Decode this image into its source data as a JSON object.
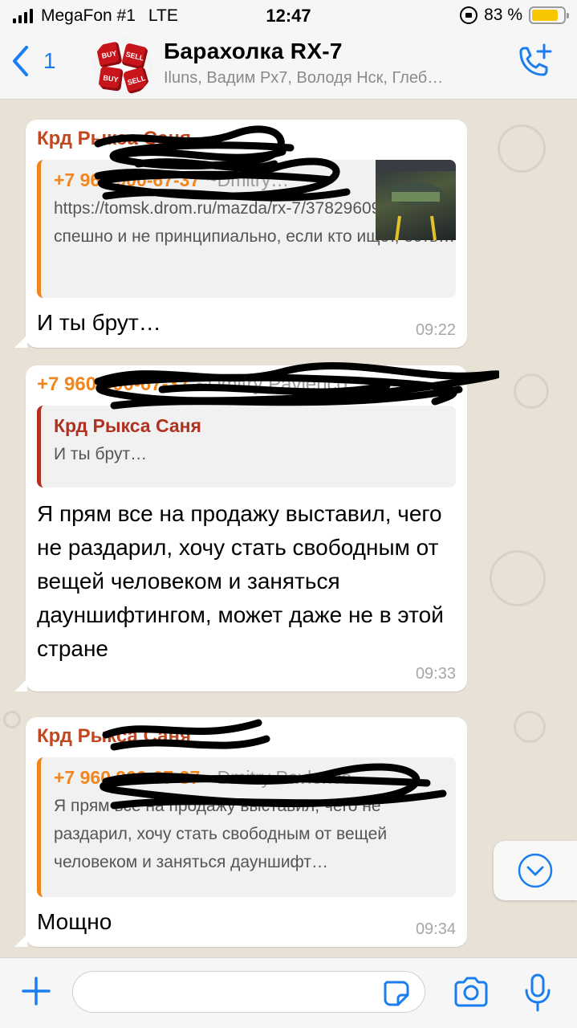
{
  "status_bar": {
    "carrier": "MegaFon #1",
    "network": "LTE",
    "time": "12:47",
    "battery": "83 %",
    "battery_level": 0.83
  },
  "header": {
    "back_count": "1",
    "title": "Барахолка RX-7",
    "subtitle": "Iluns, Вадим Px7, Володя Нск, Глеб…",
    "avatar_dice": [
      "BUY",
      "BUY",
      "SELL",
      "SELL"
    ]
  },
  "messages": [
    {
      "sender": "Крд Рыкса Саня",
      "quote_author": "+7 960 900-67-37",
      "quote_author_extra": "~Dmitry…",
      "quote_text": "https://tomsk.drom.ru/mazda/rx-7/37829609.html не спешно и не принципиально, если кто ищет, есть…",
      "text": "И ты брут…",
      "time": "09:22"
    },
    {
      "sender": "+7 960 900-67-37",
      "sender_extra": "~Dmitry Pavlenco",
      "quote_author": "Крд Рыкса Саня",
      "quote_text": "И ты брут…",
      "text": "Я прям все на продажу выставил, чего не раздарил, хочу стать свободным от вещей человеком и заняться дауншифтингом, может даже не в этой стране",
      "time": "09:33"
    },
    {
      "sender": "Крд Рыкса Саня",
      "quote_author": "+7 960 900-67-37",
      "quote_author_extra": "~Dmitry Pavlenco",
      "quote_text": "Я прям все на продажу выставил, чего не раздарил, хочу стать свободным от вещей человеком и заняться дауншифт…",
      "text": "Мощно",
      "time": "09:34"
    }
  ],
  "input": {
    "placeholder": "",
    "value": ""
  },
  "colors": {
    "accent": "#1a7ef1",
    "sender_red": "#c2461f",
    "sender_orange": "#f0861d",
    "battery": "#f7c600"
  },
  "icons": [
    "back-chevron-icon",
    "call-add-icon",
    "chevron-down-icon",
    "plus-icon",
    "sticker-icon",
    "camera-icon",
    "microphone-icon"
  ]
}
